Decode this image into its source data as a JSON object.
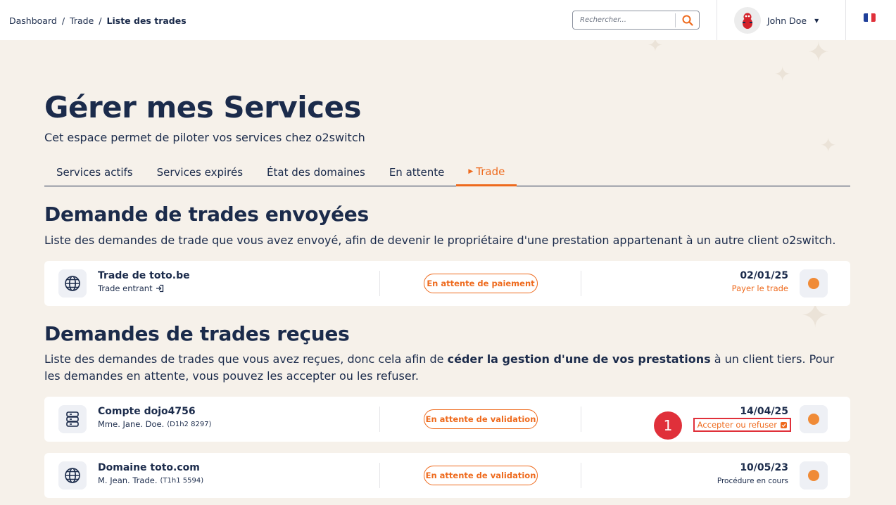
{
  "breadcrumb": {
    "items": [
      "Dashboard",
      "Trade"
    ],
    "separator": "/",
    "current": "Liste des trades"
  },
  "search": {
    "placeholder": "Rechercher..."
  },
  "user": {
    "name": "John Doe"
  },
  "language": {
    "flag": "fr-flag-icon"
  },
  "page": {
    "title": "Gérer mes Services",
    "subtitle": "Cet espace permet de piloter vos services chez o2switch"
  },
  "tabs": [
    {
      "label": "Services actifs"
    },
    {
      "label": "Services expirés"
    },
    {
      "label": "État des domaines"
    },
    {
      "label": "En attente"
    },
    {
      "label": "Trade"
    }
  ],
  "sent": {
    "title": "Demande de trades envoyées",
    "description": "Liste des demandes de trade que vous avez envoyé, afin de devenir le propriétaire d'une prestation appartenant à un autre client o2switch.",
    "items": [
      {
        "icon": "globe-icon",
        "name": "Trade de toto.be",
        "sub": "Trade entrant",
        "status": "En attente de paiement",
        "date": "02/01/25",
        "action": "Payer le trade"
      }
    ]
  },
  "received": {
    "title": "Demandes de trades reçues",
    "description_start": "Liste des demandes de trades que vous avez reçues, donc cela afin de ",
    "description_bold": "céder la gestion d'une de vos prestations",
    "description_end": " à un client tiers. Pour les demandes en attente, vous pouvez les accepter ou les refuser.",
    "items": [
      {
        "icon": "server-icon",
        "name": "Compte dojo4756",
        "sub": "Mme. Jane. Doe.",
        "sub_id": "(D1h2 8297)",
        "status": "En attente de validation",
        "date": "14/04/25",
        "action": "Accepter ou refuser"
      },
      {
        "icon": "globe-icon",
        "name": "Domaine toto.com",
        "sub": "M. Jean. Trade.",
        "sub_id": "(T1h1 5594)",
        "status": "En attente de validation",
        "date": "10/05/23",
        "status_text": "Procédure en cours"
      }
    ]
  },
  "annotation": {
    "marker": "1"
  },
  "colors": {
    "accent": "#ee6a1d",
    "navy": "#1b2b4b",
    "background": "#f6f1ea",
    "marker": "#e0303a"
  }
}
